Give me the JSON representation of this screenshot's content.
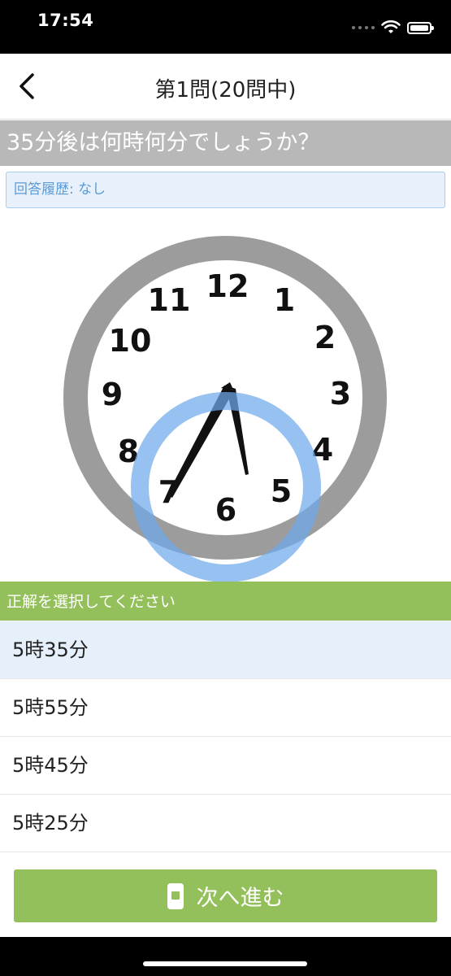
{
  "status_bar": {
    "time": "17:54"
  },
  "nav": {
    "title": "第1問(20問中)"
  },
  "question": {
    "text": "35分後は何時何分でしょうか？"
  },
  "history": {
    "text": "回答履歴: なし"
  },
  "clock": {
    "numbers": [
      "12",
      "1",
      "2",
      "3",
      "4",
      "5",
      "6",
      "7",
      "8",
      "9",
      "10",
      "11"
    ],
    "time_shown": {
      "hour": 5,
      "minute": 35
    },
    "highlight_ring_color": "#8fbff0",
    "face_border_color": "#9c9c9c"
  },
  "prompt": {
    "text": "正解を選択してください"
  },
  "answers": [
    {
      "label": "5時35分",
      "selected": true
    },
    {
      "label": "5時55分",
      "selected": false
    },
    {
      "label": "5時45分",
      "selected": false
    },
    {
      "label": "5時25分",
      "selected": false
    }
  ],
  "next_button": {
    "label": "次へ進む"
  },
  "colors": {
    "accent_green": "#94c05b",
    "history_blue": "#5a9bd8"
  }
}
